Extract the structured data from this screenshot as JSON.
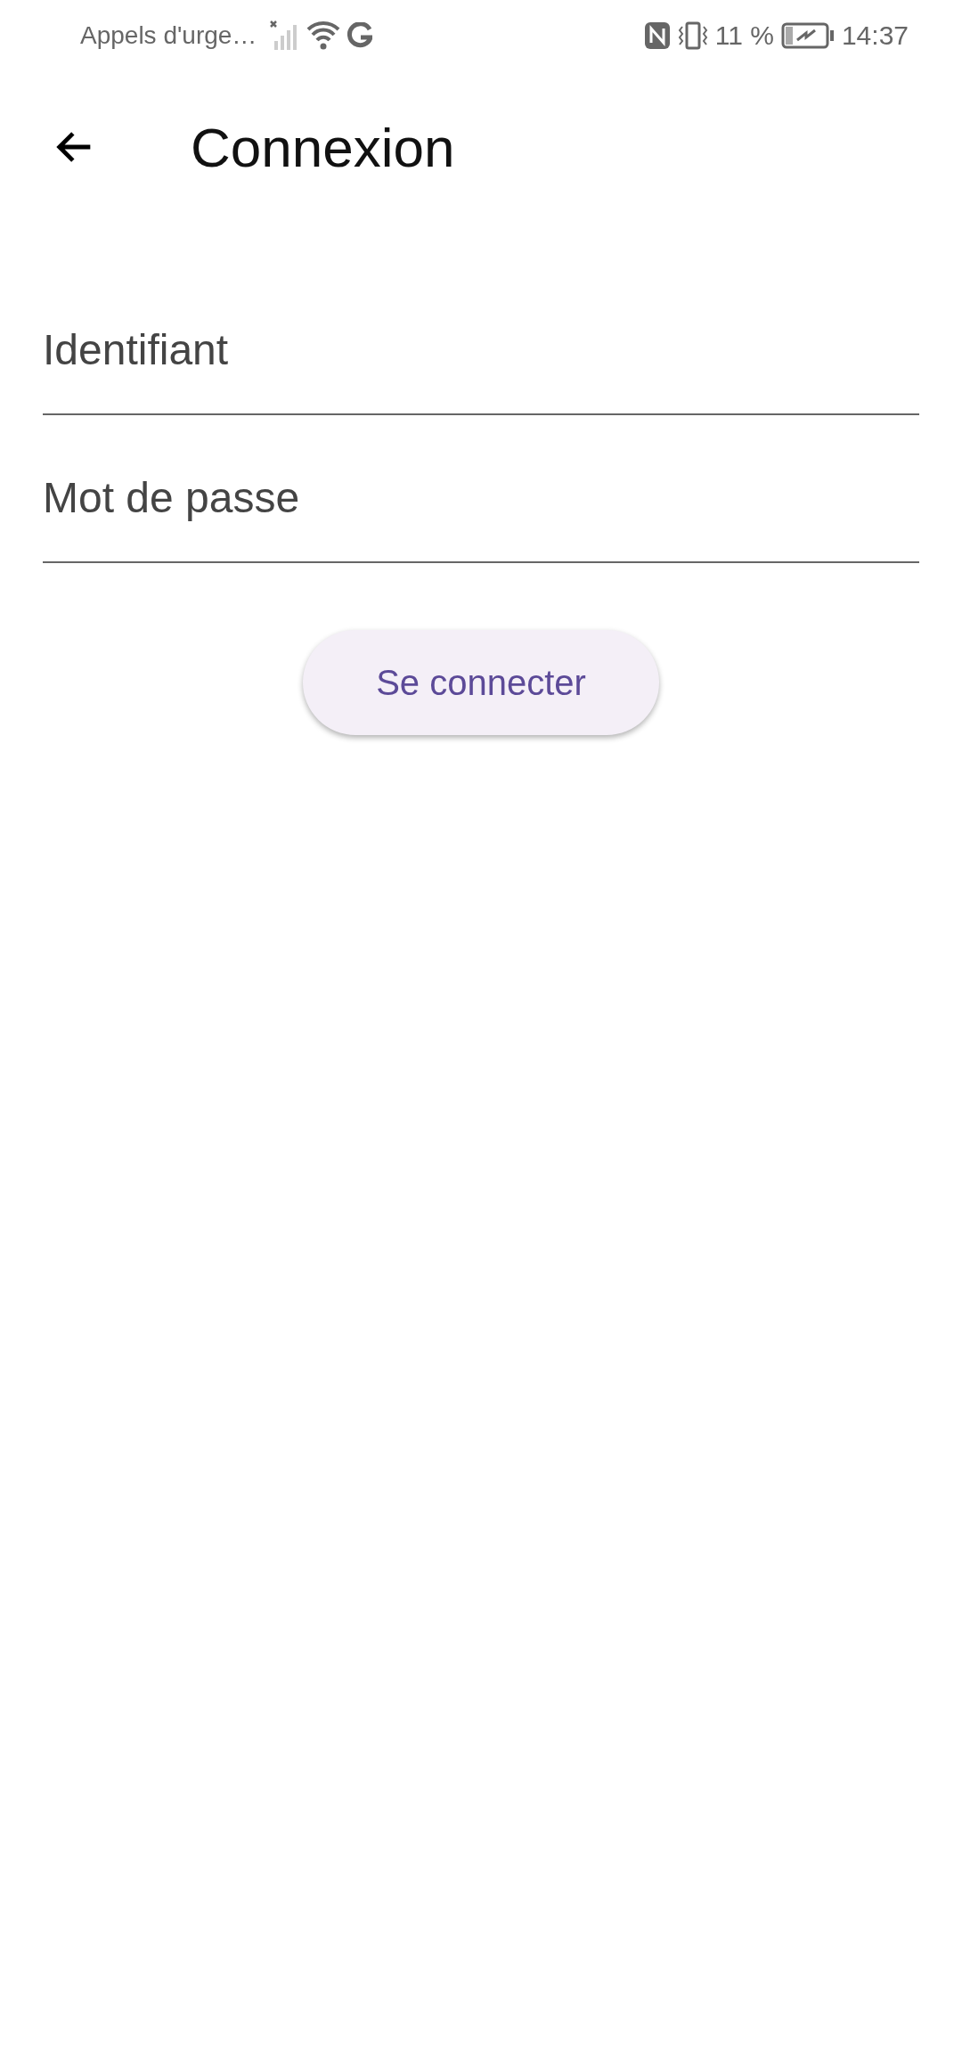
{
  "status_bar": {
    "carrier": "Appels d'urge…",
    "battery": "11 %",
    "time": "14:37"
  },
  "app_bar": {
    "title": "Connexion"
  },
  "fields": [
    {
      "placeholder": "Identifiant"
    },
    {
      "placeholder": "Mot de passe"
    }
  ],
  "button": {
    "label": "Se connecter"
  }
}
